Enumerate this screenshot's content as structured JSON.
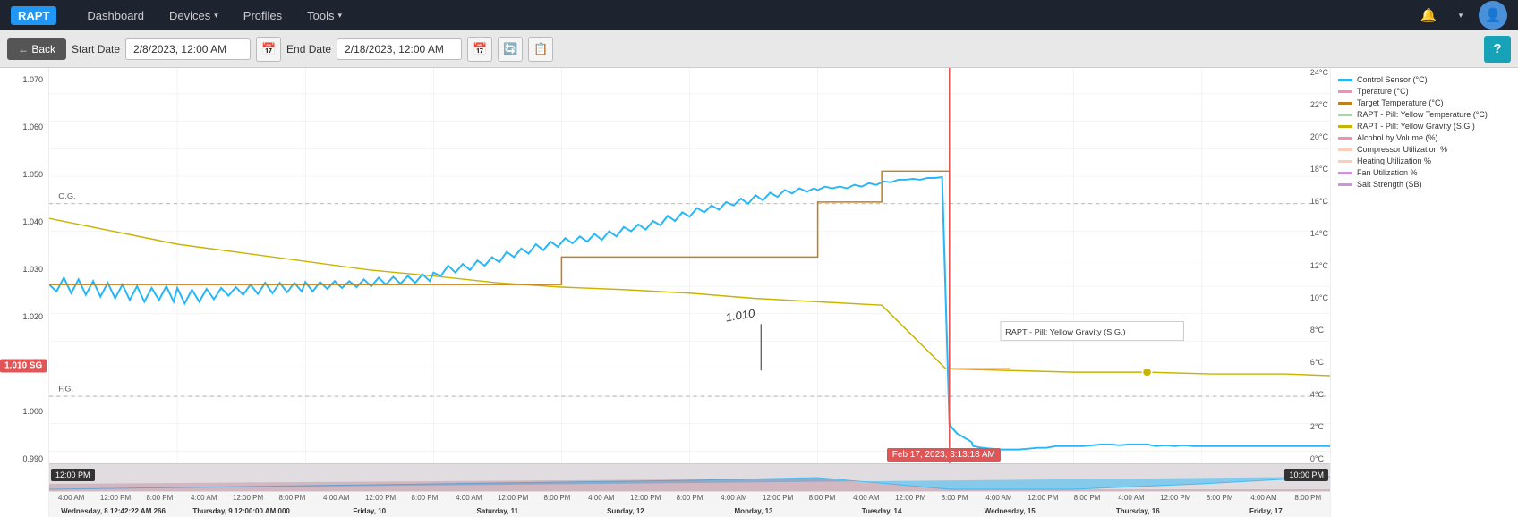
{
  "navbar": {
    "logo": "RAPT",
    "links": [
      {
        "label": "Dashboard",
        "has_dropdown": false
      },
      {
        "label": "Devices",
        "has_dropdown": true
      },
      {
        "label": "Profiles",
        "has_dropdown": false
      },
      {
        "label": "Tools",
        "has_dropdown": true
      }
    ],
    "notification_icon": "🔔",
    "user_icon": "👤"
  },
  "toolbar": {
    "back_label": "← Back",
    "start_date_label": "Start Date",
    "start_date_value": "2/8/2023, 12:00 AM",
    "end_date_label": "End Date",
    "end_date_value": "2/18/2023, 12:00 AM",
    "help_label": "?"
  },
  "chart": {
    "y_labels": [
      "1.070",
      "1.060",
      "1.050",
      "1.040",
      "1.030",
      "1.020",
      "1.010",
      "1.000",
      "0.990"
    ],
    "y_temp_labels": [
      "24°C",
      "22°C",
      "20°C",
      "18°C",
      "16°C",
      "14°C",
      "12°C",
      "10°C",
      "8°C",
      "6°C",
      "4°C",
      "2°C",
      "0°C"
    ],
    "og_label": "O.G.",
    "fg_label": "F.G.",
    "sg_badge": "1.010 SG",
    "tooltip_text": "RAPT - Pill: Yellow Gravity (S.G.)",
    "datetime_badge": "Feb 17, 2023, 3:13:18 AM",
    "annotation_text": "1.010",
    "time_labels_row1": [
      "4:00 AM",
      "12:00 PM",
      "8:00 PM",
      "4:00 AM",
      "12:00 PM",
      "8:00 PM",
      "4:00 AM",
      "12:00 PM",
      "8:00 PM",
      "4:00 AM",
      "12:00 PM",
      "8:00 PM",
      "4:00 AM",
      "12:00 PM",
      "8:00 PM",
      "4:00 AM",
      "12:00 PM",
      "8:00 PM",
      "4:00 AM",
      "12:00 PM",
      "8:00 PM",
      "4:00 AM",
      "12:00 PM",
      "8:00 PM",
      "4:00 AM",
      "12:00 PM",
      "8:00 PM",
      "4:00 AM",
      "8:00 PM"
    ],
    "date_labels": [
      "Wednesday, 8 12:42:22 AM 266",
      "Thursday, 9 12:00:00 AM 000",
      "Friday, 10",
      "Saturday, 11",
      "Sunday, 12",
      "Monday, 13",
      "Tuesday, 14",
      "Wednesday, 15",
      "Thursday, 16",
      "Friday, 17"
    ],
    "time_left_badge": "12:00 PM",
    "time_right_badge": "10:00 PM"
  },
  "legend": {
    "items": [
      {
        "label": "Control Sensor (°C)",
        "color": "#29b6f6",
        "type": "solid"
      },
      {
        "label": "Tperature (°C)",
        "color": "#f48fb1",
        "type": "solid"
      },
      {
        "label": "Target Temperature (°C)",
        "color": "#bf8020",
        "type": "solid"
      },
      {
        "label": "RAPT - Pill: Yellow Temperature (°C)",
        "color": "#a5d6a7",
        "type": "solid"
      },
      {
        "label": "RAPT - Pill: Yellow Gravity (S.G.)",
        "color": "#c8b400",
        "type": "solid"
      },
      {
        "label": "Alcohol by Volume (%)",
        "color": "#f48fb1",
        "type": "solid"
      },
      {
        "label": "Compressor Utilization %",
        "color": "#ffccbc",
        "type": "solid"
      },
      {
        "label": "Heating Utilization %",
        "color": "#ffccbc",
        "type": "solid"
      },
      {
        "label": "Fan Utilization %",
        "color": "#ce93d8",
        "type": "solid"
      },
      {
        "label": "Salt Strength (SB)",
        "color": "#ce93d8",
        "type": "solid"
      }
    ]
  }
}
